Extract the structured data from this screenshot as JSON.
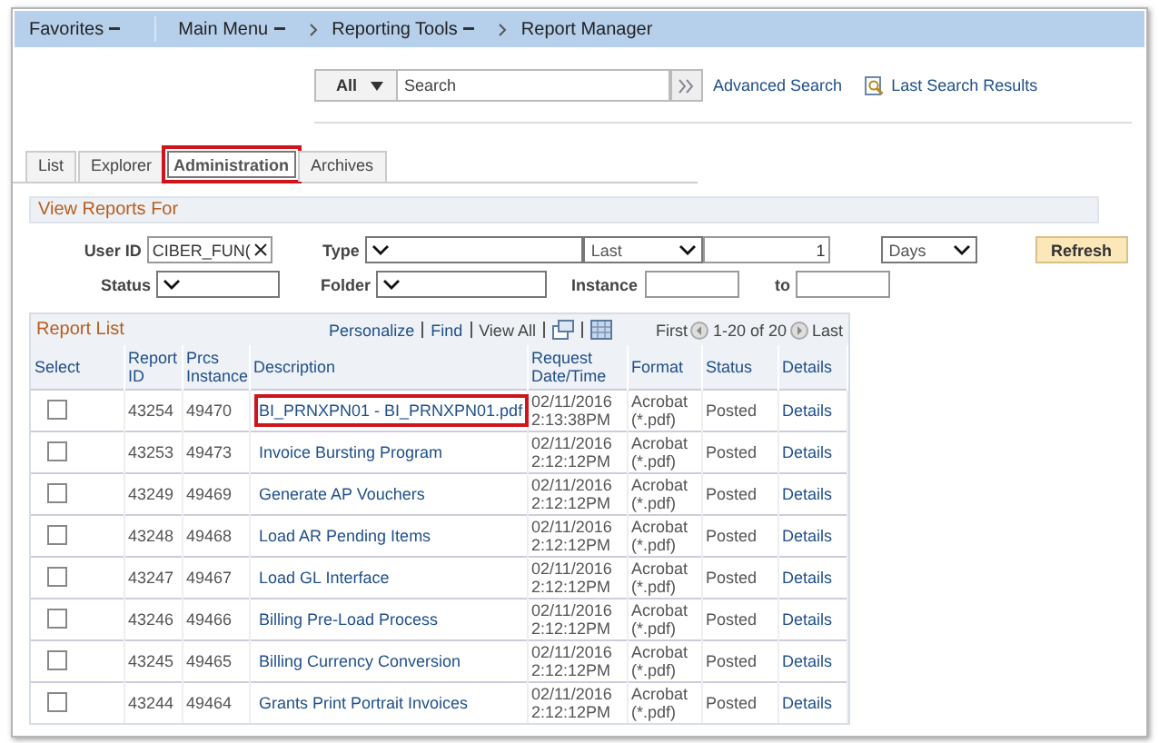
{
  "nav": {
    "items": [
      {
        "label": "Favorites",
        "kind": "menu"
      },
      {
        "label": "Main Menu",
        "kind": "menu"
      },
      {
        "label": "Reporting Tools",
        "kind": "crumb-menu"
      },
      {
        "label": "Report Manager",
        "kind": "crumb"
      }
    ]
  },
  "search": {
    "scope": "All",
    "placeholder": "Search",
    "advanced": "Advanced Search",
    "last_results": "Last Search Results"
  },
  "tabs": [
    {
      "label": "List",
      "selected": false,
      "highlighted": false
    },
    {
      "label": "Explorer",
      "selected": false,
      "highlighted": false
    },
    {
      "label": "Administration",
      "selected": true,
      "highlighted": true
    },
    {
      "label": "Archives",
      "selected": false,
      "highlighted": false
    }
  ],
  "filters": {
    "title": "View Reports For",
    "user_id_label": "User ID",
    "user_id": "CIBER_FUN(",
    "type_label": "Type",
    "period": "Last",
    "count": "1",
    "unit": "Days",
    "refresh": "Refresh",
    "status_label": "Status",
    "folder_label": "Folder",
    "instance_label": "Instance",
    "to_label": "to"
  },
  "report_list": {
    "title": "Report List",
    "personalize": "Personalize",
    "find": "Find",
    "view_all": "View All",
    "first": "First",
    "range": "1-20 of 20",
    "last": "Last",
    "columns": [
      "Select",
      "Report ID",
      "Prcs Instance",
      "Description",
      "Request Date/Time",
      "Format",
      "Status",
      "Details"
    ],
    "rows": [
      {
        "checked": false,
        "report_id": "43254",
        "instance": "49470",
        "description": "BI_PRNXPN01 - BI_PRNXPN01.pdf",
        "date": "02/11/2016",
        "time": "2:13:38PM",
        "format": "Acrobat",
        "format_ext": "(*.pdf)",
        "status": "Posted",
        "details": "Details",
        "highlighted": true
      },
      {
        "checked": false,
        "report_id": "43253",
        "instance": "49473",
        "description": "Invoice Bursting Program",
        "date": "02/11/2016",
        "time": "2:12:12PM",
        "format": "Acrobat",
        "format_ext": "(*.pdf)",
        "status": "Posted",
        "details": "Details",
        "highlighted": false
      },
      {
        "checked": false,
        "report_id": "43249",
        "instance": "49469",
        "description": "Generate AP Vouchers",
        "date": "02/11/2016",
        "time": "2:12:12PM",
        "format": "Acrobat",
        "format_ext": "(*.pdf)",
        "status": "Posted",
        "details": "Details",
        "highlighted": false
      },
      {
        "checked": false,
        "report_id": "43248",
        "instance": "49468",
        "description": "Load AR Pending Items",
        "date": "02/11/2016",
        "time": "2:12:12PM",
        "format": "Acrobat",
        "format_ext": "(*.pdf)",
        "status": "Posted",
        "details": "Details",
        "highlighted": false
      },
      {
        "checked": false,
        "report_id": "43247",
        "instance": "49467",
        "description": "Load GL Interface",
        "date": "02/11/2016",
        "time": "2:12:12PM",
        "format": "Acrobat",
        "format_ext": "(*.pdf)",
        "status": "Posted",
        "details": "Details",
        "highlighted": false
      },
      {
        "checked": false,
        "report_id": "43246",
        "instance": "49466",
        "description": "Billing Pre-Load Process",
        "date": "02/11/2016",
        "time": "2:12:12PM",
        "format": "Acrobat",
        "format_ext": "(*.pdf)",
        "status": "Posted",
        "details": "Details",
        "highlighted": false
      },
      {
        "checked": false,
        "report_id": "43245",
        "instance": "49465",
        "description": "Billing Currency Conversion",
        "date": "02/11/2016",
        "time": "2:12:12PM",
        "format": "Acrobat",
        "format_ext": "(*.pdf)",
        "status": "Posted",
        "details": "Details",
        "highlighted": false
      },
      {
        "checked": false,
        "report_id": "43244",
        "instance": "49464",
        "description": "Grants Print Portrait Invoices",
        "date": "02/11/2016",
        "time": "2:12:12PM",
        "format": "Acrobat",
        "format_ext": "(*.pdf)",
        "status": "Posted",
        "details": "Details",
        "highlighted": false
      }
    ]
  }
}
